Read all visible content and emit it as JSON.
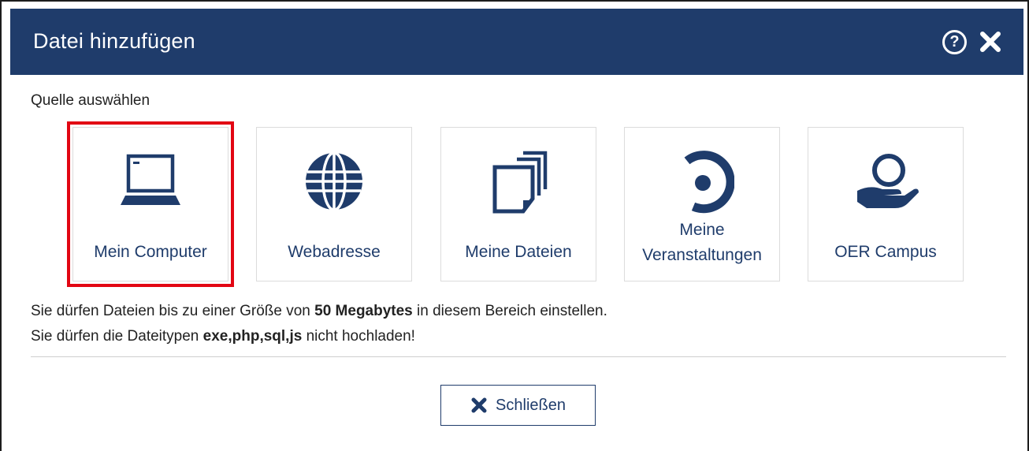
{
  "dialog": {
    "title": "Datei hinzufügen",
    "help_label": "?",
    "close_label": "✖"
  },
  "source": {
    "label": "Quelle auswählen",
    "options": [
      {
        "label": "Mein Computer",
        "icon": "laptop-icon",
        "selected": true
      },
      {
        "label": "Webadresse",
        "icon": "globe-icon",
        "selected": false
      },
      {
        "label": "Meine Dateien",
        "icon": "files-icon",
        "selected": false
      },
      {
        "label_line1": "Meine",
        "label_line2": "Veranstaltungen",
        "icon": "seminar-icon",
        "selected": false
      },
      {
        "label": "OER Campus",
        "icon": "oer-hand-icon",
        "selected": false
      }
    ]
  },
  "info": {
    "line1_pre": "Sie dürfen Dateien bis zu einer Größe von ",
    "line1_bold": "50 Megabytes",
    "line1_post": " in diesem Bereich einstellen.",
    "line2_pre": "Sie dürfen die Dateitypen ",
    "line2_bold": "exe,php,sql,js",
    "line2_post": " nicht hochladen!"
  },
  "footer": {
    "close_label": "Schließen"
  },
  "colors": {
    "brand": "#1f3c6b",
    "selection": "#e20613"
  }
}
